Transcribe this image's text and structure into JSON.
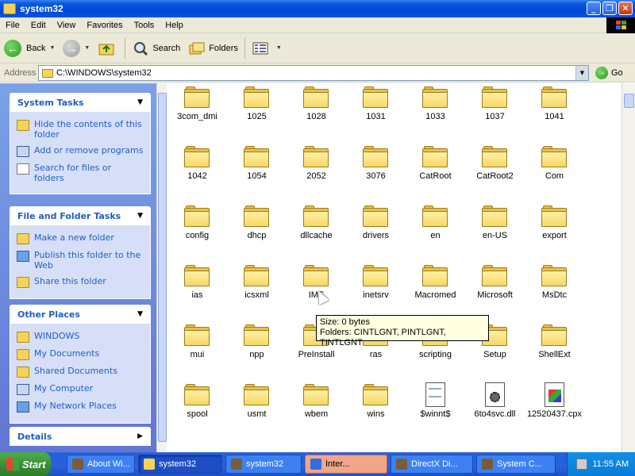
{
  "window": {
    "title": "system32"
  },
  "menu": [
    "File",
    "Edit",
    "View",
    "Favorites",
    "Tools",
    "Help"
  ],
  "toolbar": {
    "back_label": "Back",
    "search_label": "Search",
    "folders_label": "Folders"
  },
  "address": {
    "label": "Address",
    "value": "C:\\WINDOWS\\system32",
    "go_label": "Go"
  },
  "sidebar": {
    "system_tasks": {
      "title": "System Tasks",
      "items": [
        "Hide the contents of this folder",
        "Add or remove programs",
        "Search for files or folders"
      ]
    },
    "file_folder_tasks": {
      "title": "File and Folder Tasks",
      "items": [
        "Make a new folder",
        "Publish this folder to the Web",
        "Share this folder"
      ]
    },
    "other_places": {
      "title": "Other Places",
      "items": [
        "WINDOWS",
        "My Documents",
        "Shared Documents",
        "My Computer",
        "My Network Places"
      ]
    },
    "details": {
      "title": "Details"
    }
  },
  "items": [
    {
      "name": "3com_dmi",
      "type": "folder"
    },
    {
      "name": "1025",
      "type": "folder"
    },
    {
      "name": "1028",
      "type": "folder"
    },
    {
      "name": "1031",
      "type": "folder"
    },
    {
      "name": "1033",
      "type": "folder"
    },
    {
      "name": "1037",
      "type": "folder"
    },
    {
      "name": "1041",
      "type": "folder"
    },
    {
      "name": "1042",
      "type": "folder"
    },
    {
      "name": "1054",
      "type": "folder"
    },
    {
      "name": "2052",
      "type": "folder"
    },
    {
      "name": "3076",
      "type": "folder"
    },
    {
      "name": "CatRoot",
      "type": "folder"
    },
    {
      "name": "CatRoot2",
      "type": "folder"
    },
    {
      "name": "Com",
      "type": "folder"
    },
    {
      "name": "config",
      "type": "folder"
    },
    {
      "name": "dhcp",
      "type": "folder"
    },
    {
      "name": "dllcache",
      "type": "folder"
    },
    {
      "name": "drivers",
      "type": "folder"
    },
    {
      "name": "en",
      "type": "folder"
    },
    {
      "name": "en-US",
      "type": "folder"
    },
    {
      "name": "export",
      "type": "folder"
    },
    {
      "name": "ias",
      "type": "folder"
    },
    {
      "name": "icsxml",
      "type": "folder"
    },
    {
      "name": "IME",
      "type": "folder"
    },
    {
      "name": "inetsrv",
      "type": "folder"
    },
    {
      "name": "Macromed",
      "type": "folder"
    },
    {
      "name": "Microsoft",
      "type": "folder"
    },
    {
      "name": "MsDtc",
      "type": "folder"
    },
    {
      "name": "mui",
      "type": "folder"
    },
    {
      "name": "npp",
      "type": "folder"
    },
    {
      "name": "PreInstall",
      "type": "folder"
    },
    {
      "name": "ras",
      "type": "folder"
    },
    {
      "name": "scripting",
      "type": "folder"
    },
    {
      "name": "Setup",
      "type": "folder"
    },
    {
      "name": "ShellExt",
      "type": "folder"
    },
    {
      "name": "spool",
      "type": "folder"
    },
    {
      "name": "usmt",
      "type": "folder"
    },
    {
      "name": "wbem",
      "type": "folder"
    },
    {
      "name": "wins",
      "type": "folder"
    },
    {
      "name": "$winnt$",
      "type": "text-file"
    },
    {
      "name": "6to4svc.dll",
      "type": "dll-file"
    },
    {
      "name": "12520437.cpx",
      "type": "cpx-file"
    }
  ],
  "tooltip": {
    "line1": "Size: 0 bytes",
    "line2": "Folders: CINTLGNT, PINTLGNT, TINTLGNT"
  },
  "taskbar": {
    "start_label": "Start",
    "tasks": [
      {
        "label": "About Wi...",
        "state": "normal"
      },
      {
        "label": "system32",
        "state": "active"
      },
      {
        "label": "system32",
        "state": "normal"
      },
      {
        "label": "Inter...",
        "state": "ie"
      },
      {
        "label": "DirectX Di...",
        "state": "normal"
      },
      {
        "label": "System C...",
        "state": "normal"
      }
    ],
    "clock": "11:55 AM"
  },
  "colors": {
    "titlebar": "#0047d6",
    "sidebar_link": "#215dc6",
    "sidebar_bg": "#7ba2e7",
    "tooltip_bg": "#ffffe1"
  }
}
